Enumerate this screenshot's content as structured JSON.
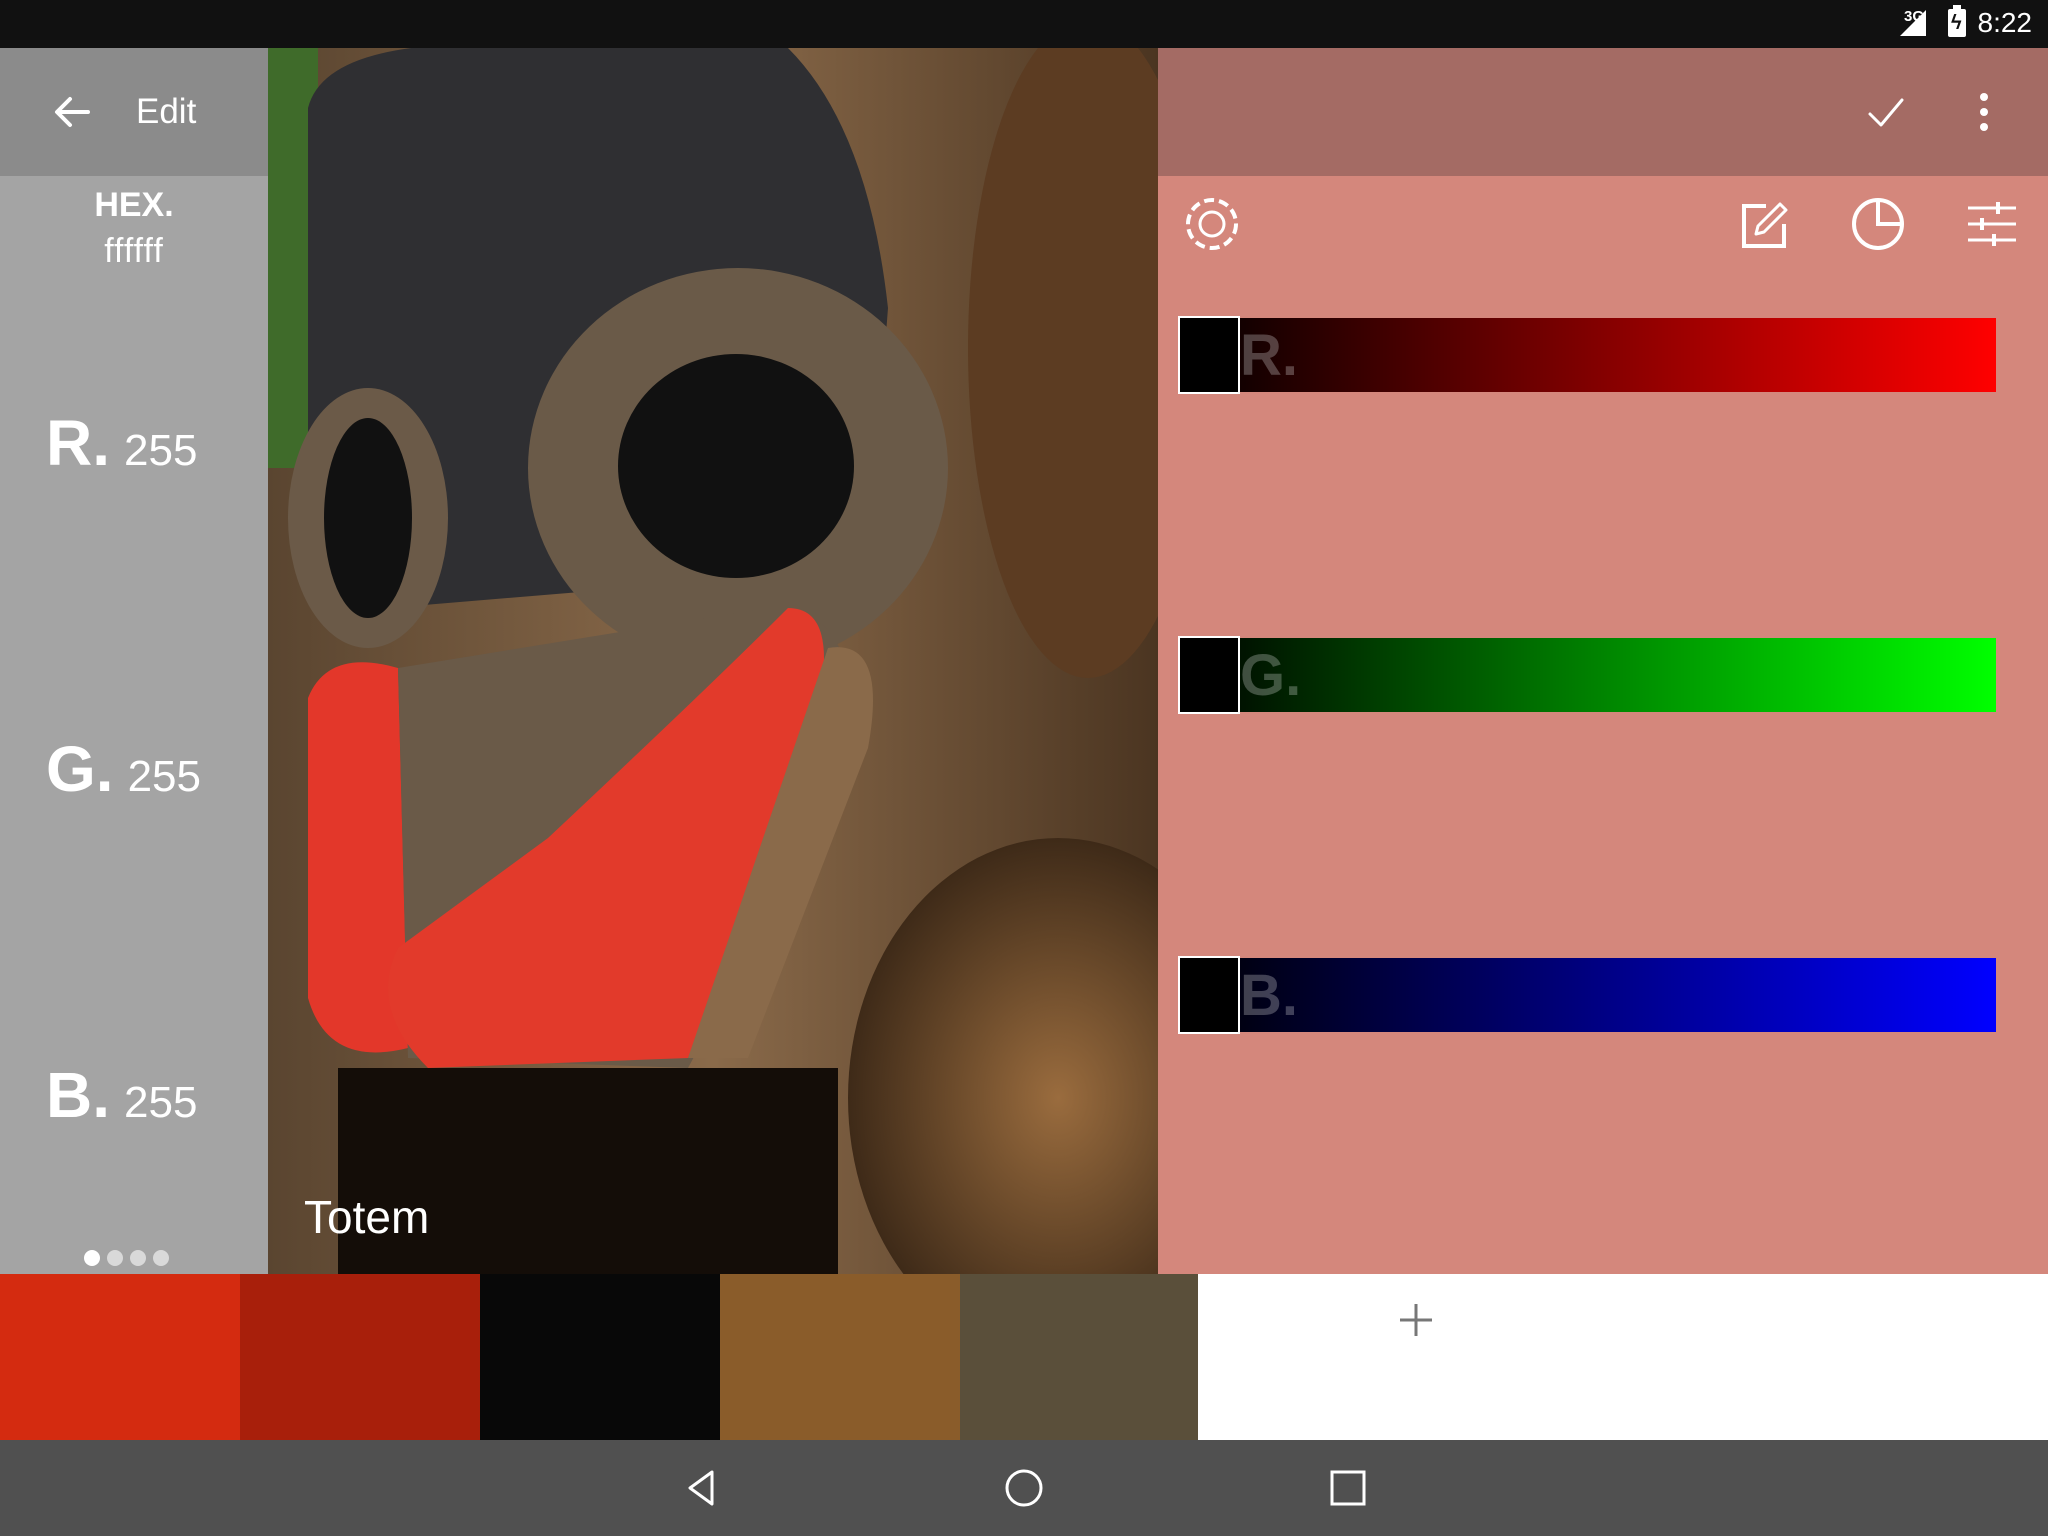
{
  "status_bar": {
    "network": "3G",
    "time": "8:22"
  },
  "toolbar": {
    "title": "Edit"
  },
  "color": {
    "hex_label": "HEX.",
    "hex_value": "ffffff",
    "r_label": "R.",
    "r_value": "255",
    "g_label": "G.",
    "g_value": "255",
    "b_label": "B.",
    "b_value": "255"
  },
  "photo": {
    "title": "Totem"
  },
  "sliders": [
    {
      "label": "R.",
      "color": "#ff0000",
      "level": 0.0
    },
    {
      "label": "G.",
      "color": "#00ff00",
      "level": 0.0
    },
    {
      "label": "B.",
      "color": "#0000ff",
      "level": 0.0
    }
  ],
  "palette": [
    "#d42b10",
    "#a81f0b",
    "#080808",
    "#8a5c2a",
    "#5a4f3a"
  ],
  "page_indicator": {
    "count": 4,
    "active": 1
  },
  "colors": {
    "right_panel": "#d4877c",
    "right_toolbar": "#a46b64",
    "left_panel": "#a4a4a4"
  },
  "icons": [
    "back-arrow-icon",
    "check-icon",
    "more-vert-icon",
    "color-wheel-icon",
    "edit-icon",
    "pie-chart-icon",
    "tune-sliders-icon",
    "add-icon",
    "nav-back-icon",
    "nav-home-icon",
    "nav-recents-icon"
  ]
}
